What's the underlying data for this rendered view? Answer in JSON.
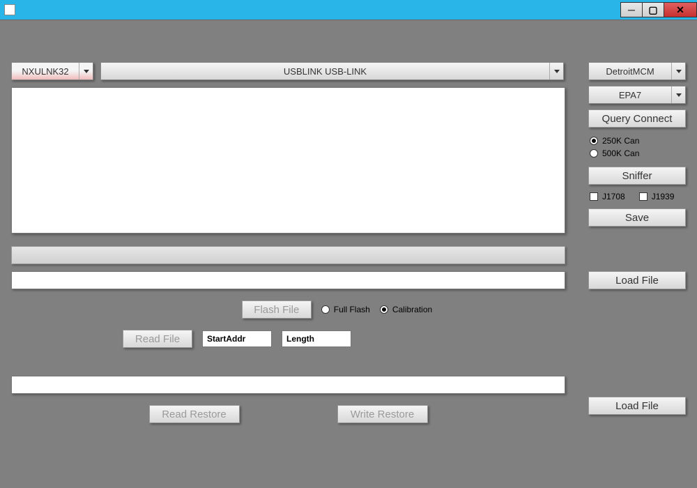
{
  "window": {
    "title": ""
  },
  "top": {
    "adapter_select": "NXULNK32",
    "device_select": "USBLINK USB-LINK"
  },
  "side": {
    "ecm_select": "DetroitMCM",
    "emission_select": "EPA7",
    "query_connect": "Query Connect",
    "can_options": {
      "opt1": "250K Can",
      "opt2": "500K Can"
    },
    "sniffer": "Sniffer",
    "protocols": {
      "p1": "J1708",
      "p2": "J1939"
    },
    "save": "Save",
    "load_file1": "Load File",
    "load_file2": "Load File"
  },
  "flash": {
    "flash_file": "Flash File",
    "full_flash": "Full Flash",
    "calibration": "Calibration",
    "read_file": "Read File",
    "start_addr": "StartAddr",
    "length": "Length"
  },
  "restore": {
    "read_restore": "Read Restore",
    "write_restore": "Write Restore"
  }
}
